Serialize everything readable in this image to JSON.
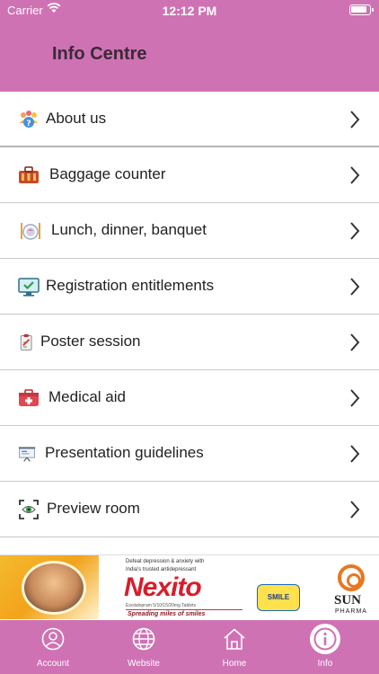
{
  "status_bar": {
    "carrier": "Carrier",
    "time": "12:12 PM"
  },
  "header": {
    "title": "Info Centre"
  },
  "menu": [
    {
      "label": "About us",
      "icon": "people-icon"
    },
    {
      "label": "Baggage counter",
      "icon": "luggage-icon"
    },
    {
      "label": "Lunch, dinner, banquet",
      "icon": "dining-icon"
    },
    {
      "label": "Registration entitlements",
      "icon": "monitor-check-icon"
    },
    {
      "label": "Poster session",
      "icon": "clipboard-icon"
    },
    {
      "label": "Medical aid",
      "icon": "first-aid-icon"
    },
    {
      "label": "Presentation guidelines",
      "icon": "projector-icon"
    },
    {
      "label": "Preview room",
      "icon": "focus-eye-icon"
    }
  ],
  "ad": {
    "tagline_top": "Defeat depression & anxiety with",
    "tagline_top2": "India's trusted antidepressant",
    "brand": "Nexito",
    "brand_sub": "Escitalopram 5/10/15/20mg Tablets",
    "spread": "Spreading miles of smiles",
    "smile_badge": "SMILE INDIA",
    "company": "SUN",
    "company_sub": "PHARMA"
  },
  "tabbar": {
    "tabs": [
      {
        "label": "Account",
        "icon": "user-circle-icon"
      },
      {
        "label": "Website",
        "icon": "globe-icon"
      },
      {
        "label": "Home",
        "icon": "home-icon"
      },
      {
        "label": "Info",
        "icon": "info-icon",
        "active": true
      }
    ]
  },
  "colors": {
    "header": "#cf72b4",
    "tabbar": "#cf72b4",
    "title_text": "#3a2a37"
  }
}
